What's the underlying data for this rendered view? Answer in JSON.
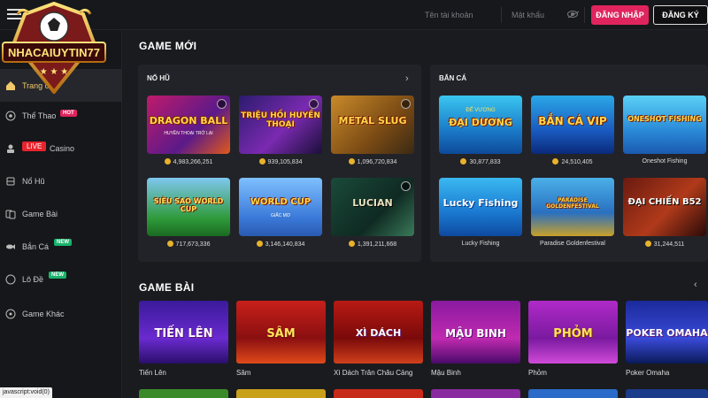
{
  "topbar": {
    "username_placeholder": "Tên tài khoản",
    "password_placeholder": "Mật khẩu",
    "login_label": "ĐĂNG NHẬP",
    "register_label": "ĐĂNG KÝ"
  },
  "logo": {
    "text": "NHACAIUYTIN77"
  },
  "sidebar": {
    "items": [
      {
        "label": "Trang chủ",
        "icon": "home-icon"
      },
      {
        "label": "Thể Thao",
        "badge": "HOT",
        "icon": "soccer-ball-icon"
      },
      {
        "label": "Casino",
        "live": "LIVE",
        "icon": "dealer-icon"
      },
      {
        "label": "Nổ Hũ",
        "icon": "jackpot-icon"
      },
      {
        "label": "Game Bài",
        "icon": "cards-icon"
      },
      {
        "label": "Bắn Cá",
        "badge": "NEW",
        "icon": "fish-icon"
      },
      {
        "label": "Lô Đề",
        "badge": "NEW",
        "icon": "lottery-icon"
      },
      {
        "label": "Game Khác",
        "icon": "gamepad-icon"
      }
    ]
  },
  "status_bar": "javascript:void(0)",
  "game_moi": {
    "title": "GAME MỚI",
    "no_hu": {
      "title": "NỔ HŨ",
      "games": [
        {
          "title": "DRAGON BALL",
          "subtitle": "HUYỀN THOẠI TRỞ LẠI",
          "value": "4,983,266,251"
        },
        {
          "title": "TRIỆU HỒI HUYỀN THOẠI",
          "subtitle": "",
          "value": "939,105,834"
        },
        {
          "title": "METAL SLUG",
          "subtitle": "",
          "value": "1,096,720,834"
        },
        {
          "title": "SIÊU SAO WORLD CUP",
          "subtitle": "",
          "value": "717,673,336"
        },
        {
          "title": "WORLD CUP",
          "subtitle": "GIẤC MƠ",
          "value": "3,146,140,834"
        },
        {
          "title": "LUCIAN",
          "subtitle": "",
          "value": "1,391,211,668"
        }
      ]
    },
    "ban_ca": {
      "title": "BẮN CÁ",
      "games": [
        {
          "title": "ĐẠI DƯƠNG",
          "subtitle": "ĐẾ VƯƠNG",
          "value": "30,877,833",
          "coin": true
        },
        {
          "title": "BẮN CÁ VIP",
          "subtitle": "",
          "value": "24,510,405",
          "coin": true
        },
        {
          "title": "ONESHOT FISHING",
          "subtitle": "",
          "value": "Oneshot Fishing",
          "coin": false
        },
        {
          "title": "Lucky Fishing",
          "subtitle": "",
          "value": "Lucky Fishing",
          "coin": false
        },
        {
          "title": "PARADISE GOLDENFESTIVAL",
          "subtitle": "",
          "value": "Paradise Goldenfestival",
          "coin": false
        },
        {
          "title": "ĐẠI CHIẾN B52",
          "subtitle": "",
          "value": "31,244,511",
          "coin": true
        }
      ]
    }
  },
  "game_bai": {
    "title": "GAME BÀI",
    "cards": [
      {
        "thumb_title": "TIẾN LÊN",
        "name": "Tiến Lên"
      },
      {
        "thumb_title": "SÂM",
        "name": "Sâm"
      },
      {
        "thumb_title": "XÌ DÁCH",
        "name": "Xì Dách Trân Châu Cảng"
      },
      {
        "thumb_title": "MẬU BINH",
        "name": "Mậu Binh"
      },
      {
        "thumb_title": "PHỎM",
        "name": "Phỏm"
      },
      {
        "thumb_title": "POKER OMAHA",
        "name": "Poker Omaha"
      }
    ]
  }
}
